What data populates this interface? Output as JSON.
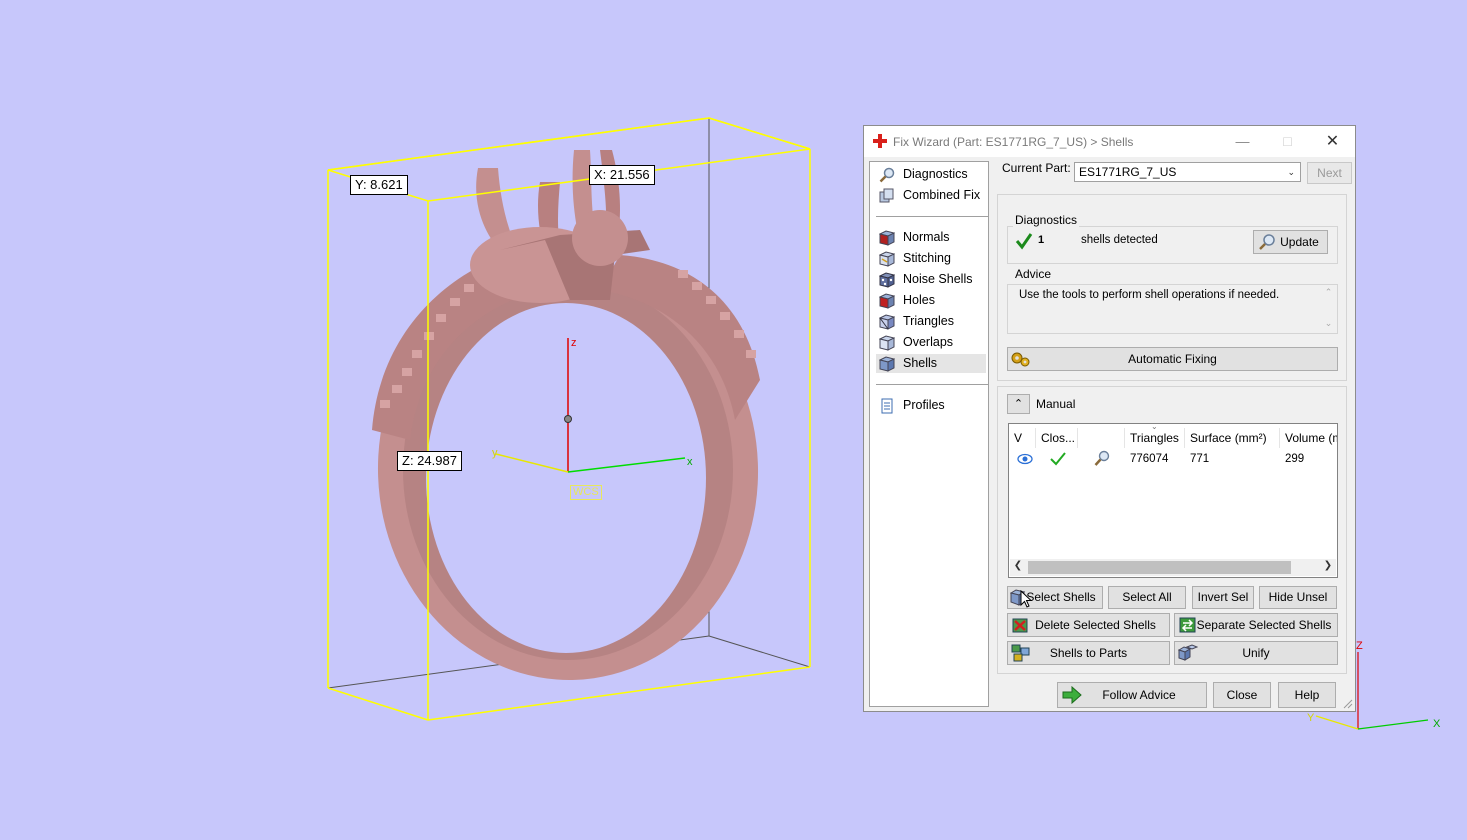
{
  "viewport": {
    "dimensions": {
      "x": "X: 21.556",
      "y": "Y: 8.621",
      "z": "Z: 24.987"
    },
    "wcs_label": "WCS",
    "axes": {
      "x": "x",
      "y": "y",
      "z": "z"
    },
    "corner_axes": {
      "x": "X",
      "y": "Y",
      "z": "Z"
    },
    "colors": {
      "background": "#c7c7fb",
      "bbox": "#ffff00",
      "ring": "#c79090"
    }
  },
  "dialog": {
    "title": "Fix Wizard (Part: ES1771RG_7_US) > Shells",
    "nav": {
      "top": [
        {
          "label": "Diagnostics",
          "icon": "magnifier-icon"
        },
        {
          "label": "Combined Fix",
          "icon": "combined-fix-icon"
        }
      ],
      "middle": [
        {
          "label": "Normals",
          "icon": "normals-icon"
        },
        {
          "label": "Stitching",
          "icon": "stitching-icon"
        },
        {
          "label": "Noise Shells",
          "icon": "noise-shells-icon"
        },
        {
          "label": "Holes",
          "icon": "holes-icon"
        },
        {
          "label": "Triangles",
          "icon": "triangles-icon"
        },
        {
          "label": "Overlaps",
          "icon": "overlaps-icon"
        },
        {
          "label": "Shells",
          "icon": "shells-icon"
        }
      ],
      "bottom": [
        {
          "label": "Profiles",
          "icon": "profiles-icon"
        }
      ],
      "active": "Shells"
    },
    "current_part_label": "Current Part:",
    "current_part_value": "ES1771RG_7_US",
    "next_button": "Next",
    "diagnostics": {
      "group_label": "Diagnostics",
      "count": "1",
      "status_text": "shells detected",
      "update_button": "Update"
    },
    "advice": {
      "group_label": "Advice",
      "text": "Use the tools to perform shell operations if needed."
    },
    "automatic_fixing_button": "Automatic Fixing",
    "manual": {
      "label": "Manual",
      "columns": [
        "V",
        "Clos...",
        "",
        "Triangles",
        "Surface (mm²)",
        "Volume (m"
      ],
      "rows": [
        {
          "visible": "eye-icon",
          "closed": "checkmark-icon",
          "action": "magnifier-icon",
          "triangles": "776074",
          "surface": "771",
          "volume": "299"
        }
      ],
      "buttons": {
        "select_shells": "Select Shells",
        "select_all": "Select All",
        "invert_sel": "Invert Sel",
        "hide_unsel": "Hide Unsel",
        "delete_selected": "Delete Selected Shells",
        "separate_selected": "Separate Selected Shells",
        "shells_to_parts": "Shells to Parts",
        "unify": "Unify"
      }
    },
    "footer": {
      "follow_advice": "Follow Advice",
      "close": "Close",
      "help": "Help"
    }
  }
}
